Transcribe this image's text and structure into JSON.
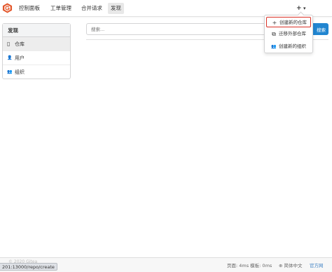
{
  "colors": {
    "accent": "#2185d0",
    "brand": "#e3572b",
    "highlight": "#d93025"
  },
  "nav": {
    "logo_icon": "gitea-logo-icon",
    "items": [
      "控制面板",
      "工单管理",
      "合并请求",
      "发现"
    ],
    "active_index": 3,
    "plus_label": "+",
    "avatar_caret": "▾"
  },
  "create_menu": {
    "items": [
      {
        "icon": "plus-icon",
        "glyph": "+",
        "label": "创建新的仓库"
      },
      {
        "icon": "repo-clone-icon",
        "glyph": "⧉",
        "label": "迁移外部仓库"
      },
      {
        "icon": "organization-icon",
        "glyph": "👥",
        "label": "创建新的组织"
      }
    ]
  },
  "sidebar": {
    "header": "发现",
    "items": [
      {
        "icon": "repo-icon",
        "glyph": "▯",
        "label": "仓库"
      },
      {
        "icon": "user-icon",
        "glyph": "👤",
        "label": "用户"
      },
      {
        "icon": "organization-icon",
        "glyph": "👥",
        "label": "组织"
      }
    ]
  },
  "search": {
    "placeholder": "搜索...",
    "button_label": "搜索"
  },
  "footer": {
    "copyright": "© 2020 Gitea",
    "perf": "页面: 4ms 模板: 0ms",
    "language_icon": "globe-icon",
    "language": "简体中文",
    "link": "官方网"
  },
  "status_url": "201:13000/repo/create"
}
